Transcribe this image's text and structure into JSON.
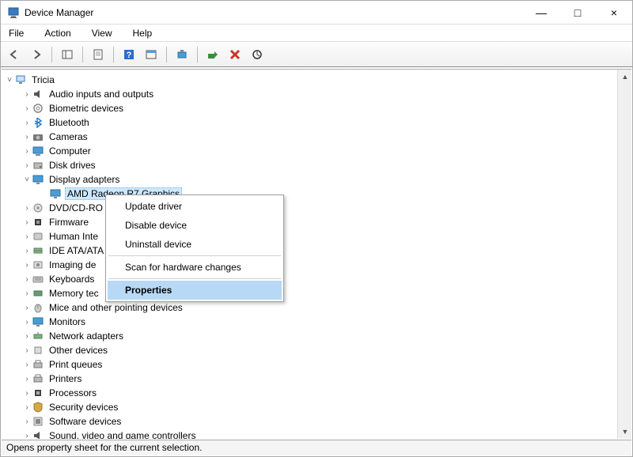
{
  "window": {
    "title": "Device Manager",
    "minimize": "—",
    "maximize": "□",
    "close": "×"
  },
  "menubar": {
    "file": "File",
    "action": "Action",
    "view": "View",
    "help": "Help"
  },
  "tree": {
    "root": "Tricia",
    "items": [
      {
        "label": "Audio inputs and outputs"
      },
      {
        "label": "Biometric devices"
      },
      {
        "label": "Bluetooth"
      },
      {
        "label": "Cameras"
      },
      {
        "label": "Computer"
      },
      {
        "label": "Disk drives"
      },
      {
        "label": "Display adapters",
        "expanded": true
      },
      {
        "label": "AMD Radeon R7 Graphics",
        "child": true,
        "selected": true,
        "truncated": "AMD Radeon R7 Graphics"
      },
      {
        "label": "DVD/CD-RO",
        "truncated": "DVD/CD-RO"
      },
      {
        "label": "Firmware"
      },
      {
        "label": "Human Inte",
        "truncated": "Human Inte"
      },
      {
        "label": "IDE ATA/ATA",
        "truncated": "IDE ATA/ATA"
      },
      {
        "label": "Imaging de",
        "truncated": "Imaging de"
      },
      {
        "label": "Keyboards"
      },
      {
        "label": "Memory tec",
        "truncated": "Memory tec"
      },
      {
        "label": "Mice and other pointing devices"
      },
      {
        "label": "Monitors"
      },
      {
        "label": "Network adapters"
      },
      {
        "label": "Other devices"
      },
      {
        "label": "Print queues"
      },
      {
        "label": "Printers"
      },
      {
        "label": "Processors"
      },
      {
        "label": "Security devices"
      },
      {
        "label": "Software devices"
      },
      {
        "label": "Sound, video and game controllers"
      }
    ]
  },
  "context_menu": {
    "update": "Update driver",
    "disable": "Disable device",
    "uninstall": "Uninstall device",
    "scan": "Scan for hardware changes",
    "properties": "Properties"
  },
  "statusbar": {
    "text": "Opens property sheet for the current selection."
  }
}
